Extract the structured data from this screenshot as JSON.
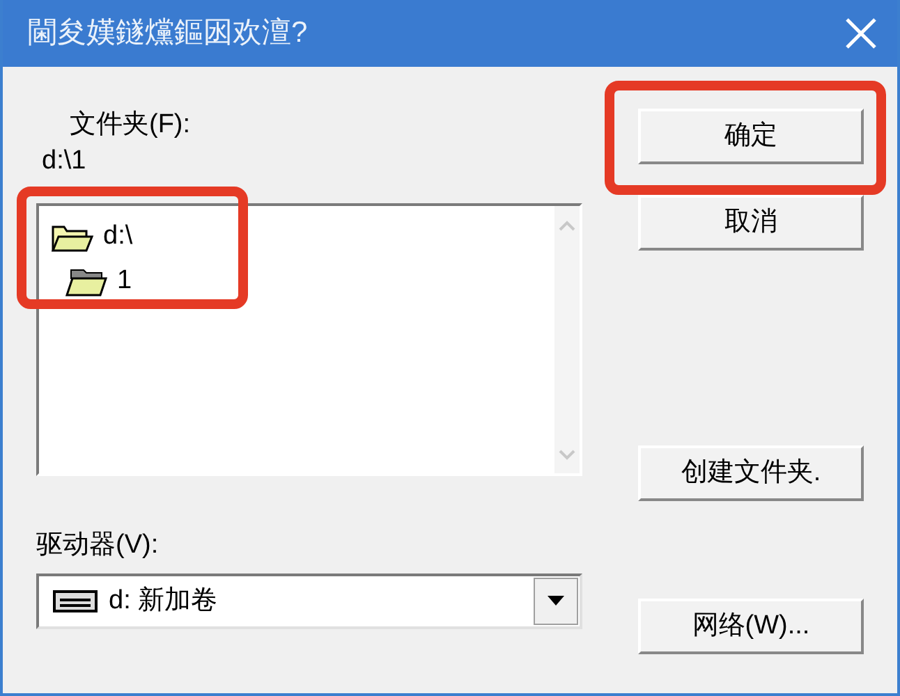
{
  "window": {
    "title": "閫夋嫨鐩爣鏂囦欢澶?"
  },
  "folder_label": "文件夹(F):",
  "current_path": "d:\\1",
  "folder_tree": {
    "highlighted": true,
    "items": [
      {
        "label": "d:\\",
        "children": [
          {
            "label": "1"
          }
        ]
      }
    ]
  },
  "drive_label": "驱动器(V):",
  "drive_select": {
    "value": "d: 新加卷"
  },
  "buttons": [
    {
      "label": "确定",
      "highlighted": true
    },
    {
      "label": "取消",
      "highlighted": false
    },
    {
      "label": "创建文件夹.",
      "highlighted": false
    },
    {
      "label": "网络(W)...",
      "highlighted": false
    }
  ]
}
